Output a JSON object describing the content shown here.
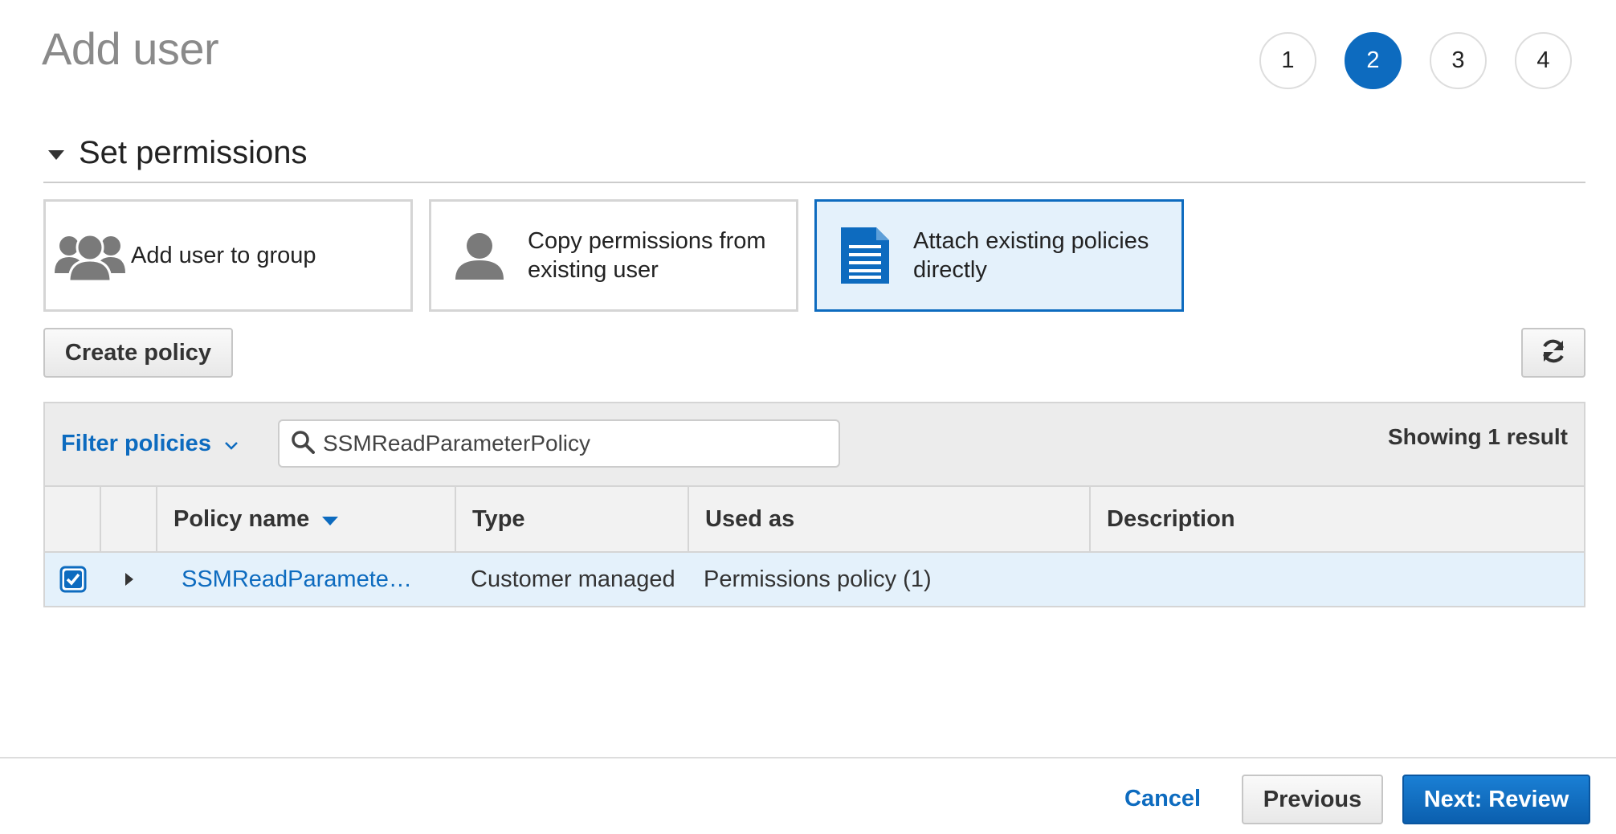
{
  "page": {
    "title": "Add user",
    "steps": [
      "1",
      "2",
      "3",
      "4"
    ],
    "active_step": "2"
  },
  "section": {
    "title": "Set permissions"
  },
  "options": [
    {
      "label": "Add user to group",
      "icon": "group-icon"
    },
    {
      "label": "Copy permissions from existing user",
      "icon": "user-icon"
    },
    {
      "label": "Attach existing policies directly",
      "icon": "document-icon",
      "selected": true
    }
  ],
  "toolbar": {
    "create_policy_label": "Create policy",
    "refresh_icon": "refresh-icon"
  },
  "filter": {
    "label": "Filter policies",
    "search_value": "SSMReadParameterPolicy",
    "showing": "Showing 1 result"
  },
  "table": {
    "columns": [
      "Policy name",
      "Type",
      "Used as",
      "Description"
    ],
    "rows": [
      {
        "checked": true,
        "policy_name": "SSMReadParamete…",
        "type": "Customer managed",
        "used_as": "Permissions policy (1)",
        "description": ""
      }
    ]
  },
  "footer": {
    "cancel_label": "Cancel",
    "previous_label": "Previous",
    "next_label": "Next: Review"
  },
  "colors": {
    "accent": "#0d6bbf",
    "selected_bg": "#e4f1fb"
  }
}
